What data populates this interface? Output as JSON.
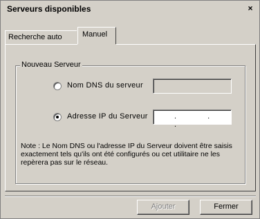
{
  "window": {
    "title": "Serveurs disponibles",
    "close_glyph": "×"
  },
  "tabs": [
    {
      "label": "Recherche auto",
      "selected": false
    },
    {
      "label": "Manuel",
      "selected": true
    }
  ],
  "group": {
    "legend": "Nouveau Serveur",
    "option_dns": {
      "label": "Nom DNS du serveur",
      "selected": false,
      "value": ""
    },
    "option_ip": {
      "label": "Adresse IP du Serveur",
      "selected": true,
      "value": ".   .   ."
    },
    "note": "Note : Le Nom DNS ou l'adresse IP du Serveur doivent être saisis exactement tels qu'ils ont été configurés ou cet utilitaire ne les repèrera pas sur le réseau."
  },
  "buttons": {
    "add_label": "Ajouter",
    "add_enabled": false,
    "close_label": "Fermer"
  }
}
